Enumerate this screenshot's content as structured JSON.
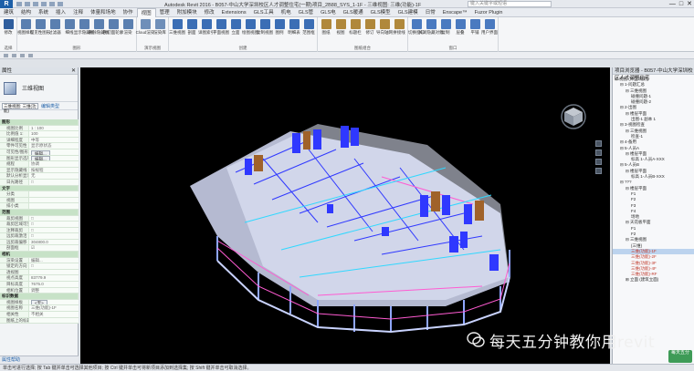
{
  "window": {
    "app_name": "Autodesk Revit 2016 -",
    "title": "B057-中山大学深圳校区人才调整住宅(一期)项目_2B88_SYS_1-1F - 三维视图: 三维(功能)-1F",
    "search_placeholder": "键入关键字或短语",
    "controls": [
      "—",
      "□",
      "✕"
    ]
  },
  "ribbon": {
    "tabs": [
      "建筑",
      "结构",
      "系统",
      "插入",
      "注释",
      "体量和场地",
      "协作",
      "视图",
      "管理",
      "附加模块",
      "修改",
      "Extensions",
      "GLS工具",
      "机电",
      "GLS管",
      "GLS电",
      "GLS暖通",
      "GLS模型",
      "GLS建模",
      "日常",
      "Enscape™",
      "Fuzor Plugin"
    ],
    "active_tab": "视图",
    "groups": [
      {
        "label": "选择",
        "buttons": [
          "修改"
        ],
        "accent": "#2f5e9e"
      },
      {
        "label": "图形",
        "buttons": [
          "视图样板",
          "可见性图形",
          "过滤器",
          "细线",
          "显示隐藏线",
          "删除隐藏线",
          "剖切面轮廓",
          "渲染"
        ],
        "accent": "#5a7fb0"
      },
      {
        "label": "演示视图",
        "buttons": [
          "Cloud渲染",
          "渲染库"
        ],
        "accent": "#6f8fb9"
      },
      {
        "label": "创建",
        "buttons": [
          "三维视图",
          "剖面",
          "详图索引",
          "平面视图",
          "立面",
          "绘图视图",
          "复制视图",
          "图例",
          "明细表",
          "范围框"
        ],
        "accent": "#3b6eb5"
      },
      {
        "label": "图纸组合",
        "buttons": [
          "图纸",
          "视图",
          "标题栏",
          "修订",
          "导向轴网",
          "拼接线"
        ],
        "accent": "#b0883b"
      },
      {
        "label": "窗口",
        "buttons": [
          "切换窗口",
          "关闭隐藏对象",
          "复制",
          "层叠",
          "平铺",
          "用户界面"
        ],
        "accent": "#4a7ac0"
      }
    ]
  },
  "properties": {
    "panel_title": "属性",
    "type_name": "三维视图",
    "type_selector": "三维视图: 三维(功能)",
    "edit_type_label": "编辑类型",
    "rows": [
      {
        "section": true,
        "k": "图形"
      },
      {
        "k": "视图比例",
        "v": "1 : 100"
      },
      {
        "k": "比例值 1:",
        "v": "100"
      },
      {
        "k": "详细程度",
        "v": "中等"
      },
      {
        "k": "零件可见性",
        "v": "显示原状态"
      },
      {
        "k": "可见性/图形替换",
        "v": "编辑...",
        "btn": true
      },
      {
        "k": "图形显示选项",
        "v": "编辑...",
        "btn": true
      },
      {
        "k": "规程",
        "v": "协调"
      },
      {
        "k": "显示隐藏线",
        "v": "按规程"
      },
      {
        "k": "默认分析显示样式",
        "v": "无"
      },
      {
        "k": "日光路径",
        "v": "□"
      },
      {
        "section": true,
        "k": "文字"
      },
      {
        "k": "分类",
        "v": ""
      },
      {
        "k": "视图",
        "v": ""
      },
      {
        "k": "排小类",
        "v": ""
      },
      {
        "section": true,
        "k": "范围"
      },
      {
        "k": "裁剪视图",
        "v": "□"
      },
      {
        "k": "裁剪区域可见",
        "v": "□"
      },
      {
        "k": "注释裁剪",
        "v": "□"
      },
      {
        "k": "远剪裁激活",
        "v": "□"
      },
      {
        "k": "远剪裁偏移",
        "v": "304800.0"
      },
      {
        "k": "剖面框",
        "v": "☑"
      },
      {
        "section": true,
        "k": "相机"
      },
      {
        "k": "渲染设置",
        "v": "编辑..."
      },
      {
        "k": "锁定的方向",
        "v": "□"
      },
      {
        "k": "透视图",
        "v": ""
      },
      {
        "k": "视点高度",
        "v": "83779.9"
      },
      {
        "k": "目标高度",
        "v": "7675.0"
      },
      {
        "k": "相机位置",
        "v": "调整"
      },
      {
        "section": true,
        "k": "标识数据"
      },
      {
        "k": "视图样板",
        "v": "<无>",
        "btn": true
      },
      {
        "k": "视图名称",
        "v": "三维(功能)-1F"
      },
      {
        "k": "相关性",
        "v": "不相关"
      },
      {
        "k": "图纸上的标题",
        "v": ""
      }
    ],
    "footer_link": "属性帮助"
  },
  "viewport": {
    "background": "#000000",
    "viewcube_label": "TOP"
  },
  "browser": {
    "panel_title": "项目浏览器 - B057-中山大学深圳校区人才调整住宅",
    "items": [
      {
        "text": "⊟ 视图 (体型/规则)",
        "indent": 0
      },
      {
        "text": "⊟ 1-问题汇总",
        "indent": 1
      },
      {
        "text": "⊟ 三维视图",
        "indent": 2
      },
      {
        "text": "碰撞问题-1",
        "indent": 3
      },
      {
        "text": "碰撞问题-2",
        "indent": 3
      },
      {
        "text": "⊟ 2-出图",
        "indent": 1
      },
      {
        "text": "⊟ 楼层平面",
        "indent": 2
      },
      {
        "text": "出图-1 副本 1",
        "indent": 3
      },
      {
        "text": "⊟ 3-视图检查",
        "indent": 1
      },
      {
        "text": "⊟ 三维视图",
        "indent": 2
      },
      {
        "text": "检查-1",
        "indent": 3
      },
      {
        "text": "⊟ 4-备用",
        "indent": 1
      },
      {
        "text": "⊟ 5-人员A",
        "indent": 1
      },
      {
        "text": "⊟ 楼层平面",
        "indent": 2
      },
      {
        "text": "标高 1-人员A-XXX",
        "indent": 3
      },
      {
        "text": "⊟ 5-人员B",
        "indent": 1
      },
      {
        "text": "⊟ 楼层平面",
        "indent": 2
      },
      {
        "text": "标高 1-人员B-XXX",
        "indent": 3
      },
      {
        "text": "⊟ ???",
        "indent": 1
      },
      {
        "text": "⊟ 楼层平面",
        "indent": 2
      },
      {
        "text": "F1",
        "indent": 3
      },
      {
        "text": "F2",
        "indent": 3
      },
      {
        "text": "F3",
        "indent": 3
      },
      {
        "text": "F4",
        "indent": 3
      },
      {
        "text": "场地",
        "indent": 3
      },
      {
        "text": "⊟ 天花板平面",
        "indent": 2
      },
      {
        "text": "F1",
        "indent": 3
      },
      {
        "text": "F2",
        "indent": 3
      },
      {
        "text": "⊟ 三维视图",
        "indent": 2
      },
      {
        "text": "{三维}",
        "indent": 3
      },
      {
        "text": "三维(功能)-1F",
        "indent": 3,
        "selected": true,
        "red": true
      },
      {
        "text": "三维(功能)-2F",
        "indent": 3,
        "red": true
      },
      {
        "text": "三维(功能)-3F",
        "indent": 3,
        "red": true
      },
      {
        "text": "三维(功能)-4F",
        "indent": 3,
        "red": true
      },
      {
        "text": "三维(功能)-RF",
        "indent": 3,
        "red": true
      },
      {
        "text": "⊞ 立面 (建筑立面)",
        "indent": 2
      }
    ]
  },
  "status": {
    "text": "单击可进行选择; 按 Tab 键并单击可选择其他项目; 按 Ctrl 键并单击可将新项目添加到选择集; 按 Shift 键并单击可取消选择。"
  },
  "watermark": {
    "text": "每天五分钟教你用revit",
    "badge": "每天五分"
  },
  "colors": {
    "accent": "#1d5fa8",
    "model_blue": "#2f38ff",
    "model_white": "#e8ecff",
    "model_brown": "#a0622a",
    "model_pink": "#ff5bd2",
    "model_cyan": "#30d8ff"
  }
}
